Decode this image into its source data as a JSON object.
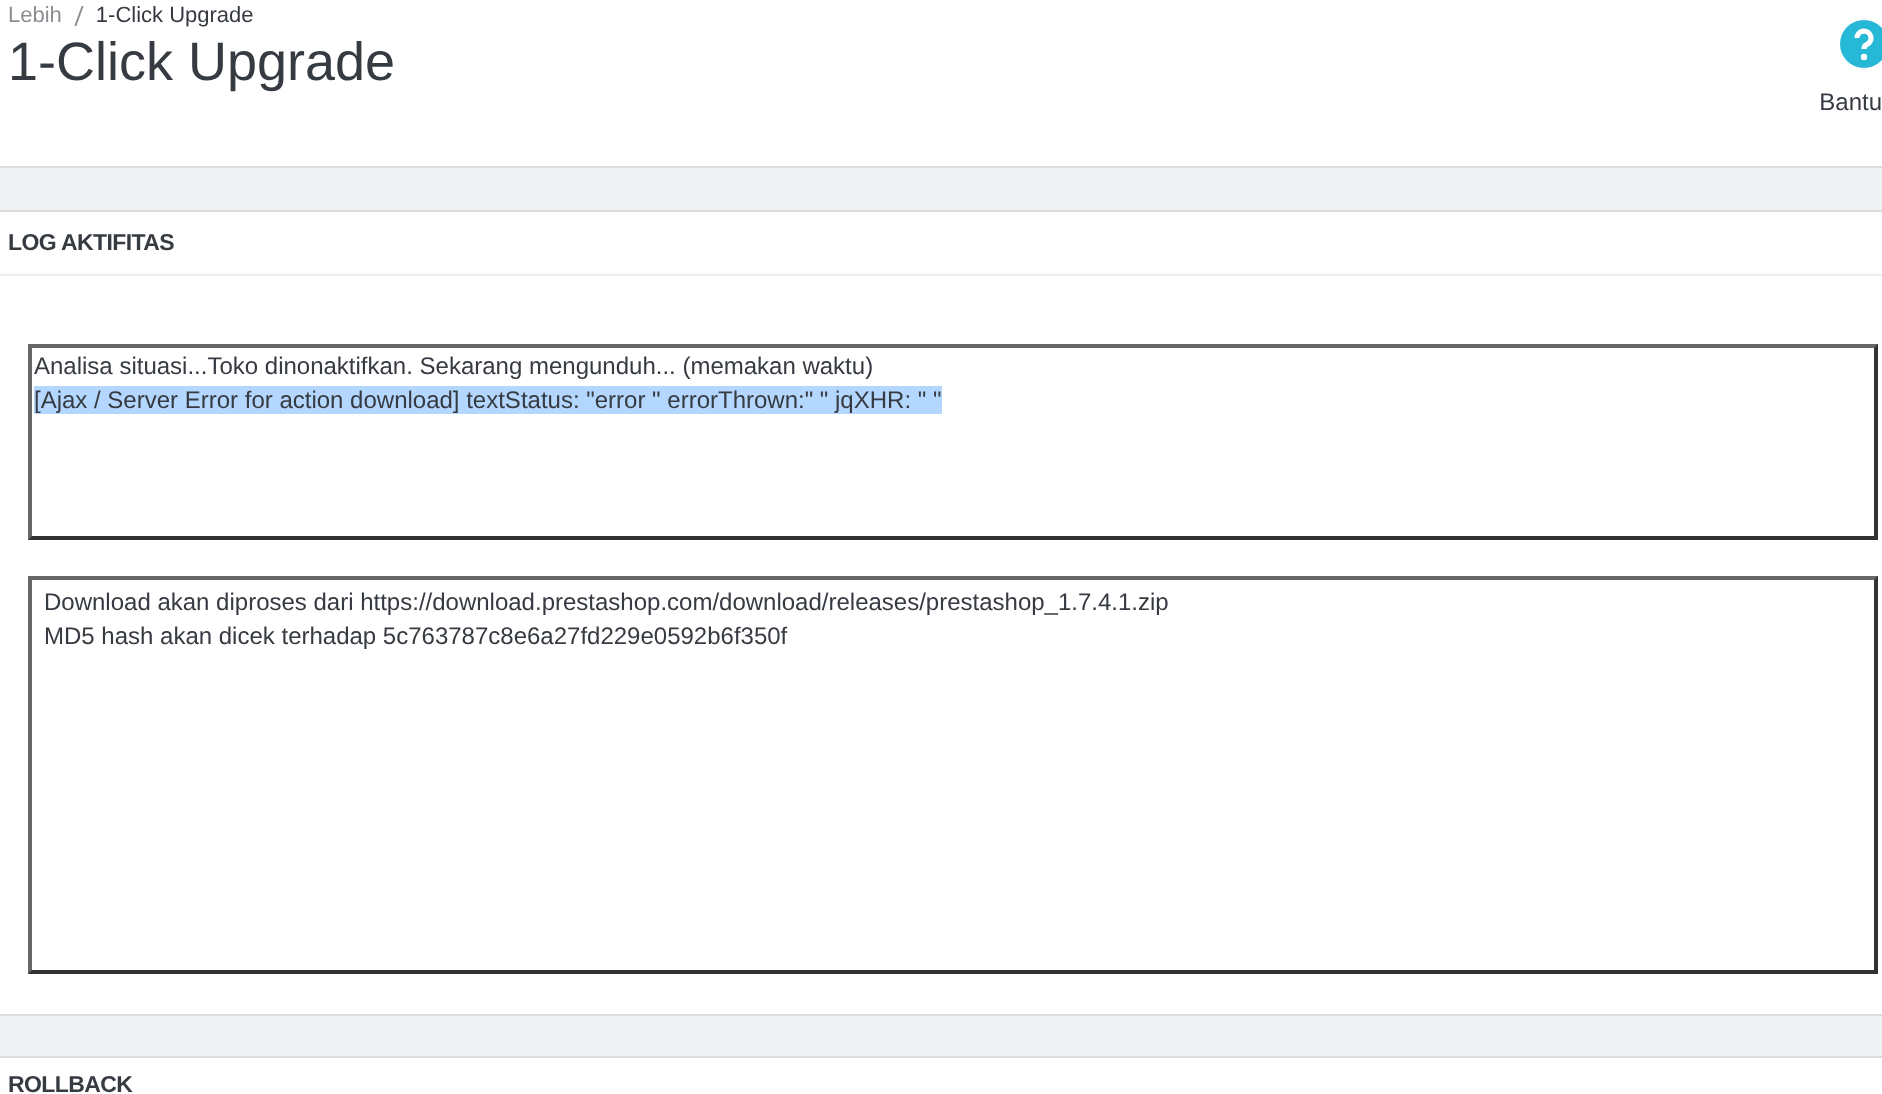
{
  "breadcrumb": [
    "Lebih",
    "1-Click Upgrade"
  ],
  "title": "1-Click Upgrade",
  "help": {
    "label": "Bantu"
  },
  "log_panel": {
    "heading": "LOG AKTIFITAS",
    "boxes": [
      {
        "lines": [
          {
            "text": "Analisa situasi...Toko dinonaktifkan. Sekarang mengunduh... (memakan waktu)",
            "highlighted": false
          },
          {
            "text": "[Ajax / Server Error for action download] textStatus: \"error \" errorThrown:\" \" jqXHR: \" \"",
            "highlighted": true
          }
        ]
      },
      {
        "lines": [
          {
            "text": "Download akan diproses dari https://download.prestashop.com/download/releases/prestashop_1.7.4.1.zip",
            "highlighted": false
          },
          {
            "text": "MD5 hash akan dicek terhadap 5c763787c8e6a27fd229e0592b6f350f",
            "highlighted": false
          }
        ]
      }
    ]
  },
  "rollback_panel": {
    "heading": "ROLLBACK"
  }
}
